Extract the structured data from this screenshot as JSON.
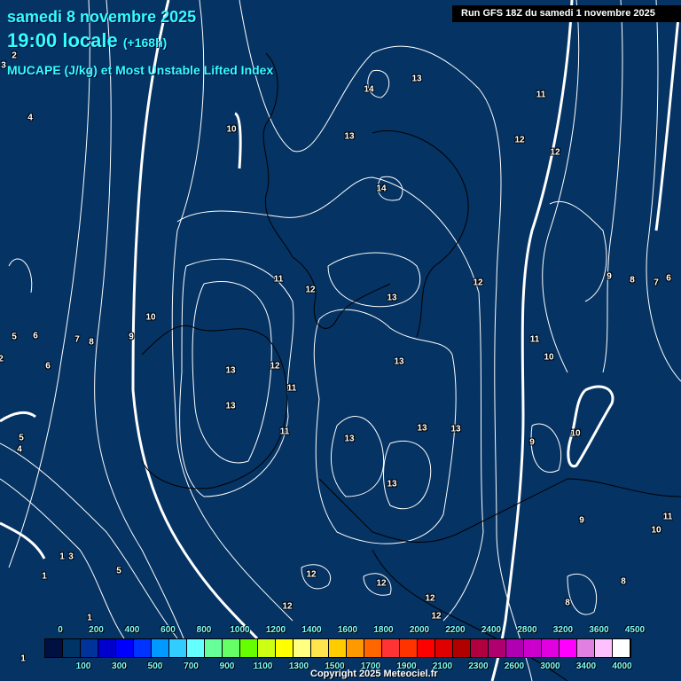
{
  "header": {
    "date": "samedi 8 novembre 2025",
    "time": "19:00 locale",
    "lead": "(+168h)",
    "parameter": "MUCAPE (J/kg) et Most Unstable Lifted Index",
    "run": "Run GFS 18Z du samedi 1 novembre 2025"
  },
  "map_labels": [
    "14",
    "13",
    "11",
    "10",
    "13",
    "12",
    "12",
    "14",
    "11",
    "12",
    "12",
    "13",
    "13",
    "13",
    "13",
    "11",
    "12",
    "11",
    "10",
    "13",
    "13",
    "13",
    "13",
    "9",
    "10",
    "9",
    "12",
    "12",
    "12",
    "11",
    "12",
    "9",
    "8",
    "7",
    "6",
    "5",
    "6",
    "7",
    "8",
    "9",
    "10",
    "6",
    "5",
    "4",
    "2",
    "3",
    "5",
    "1",
    "1",
    "1",
    "1",
    "3",
    "4",
    "2",
    "11",
    "10",
    "8",
    "8",
    "12"
  ],
  "colorbar": {
    "top_labels": [
      "0",
      "200",
      "400",
      "600",
      "800",
      "1000",
      "1200",
      "1400",
      "1600",
      "1800",
      "2000",
      "2200",
      "2400",
      "2800",
      "3200",
      "3600",
      "4500"
    ],
    "bottom_labels": [
      "100",
      "300",
      "500",
      "700",
      "900",
      "1100",
      "1300",
      "1500",
      "1700",
      "1900",
      "2100",
      "2300",
      "2600",
      "3000",
      "3400",
      "4000"
    ],
    "colors": [
      "#001040",
      "#003366",
      "#003399",
      "#0000cc",
      "#0000ff",
      "#0033ff",
      "#0099ff",
      "#33ccff",
      "#66ffff",
      "#66ff99",
      "#66ff66",
      "#66ff00",
      "#ccff11",
      "#ffff00",
      "#ffff80",
      "#ffe44d",
      "#ffcc00",
      "#ff9900",
      "#ff6600",
      "#ff3333",
      "#ff3300",
      "#ff0000",
      "#e00000",
      "#b00000",
      "#b00040",
      "#b00070",
      "#b000b0",
      "#cc00cc",
      "#e000e0",
      "#ff00ff",
      "#e080e0",
      "#ffc0ff",
      "#ffffff"
    ]
  },
  "copyright": "Copyright 2025 Meteociel.fr"
}
